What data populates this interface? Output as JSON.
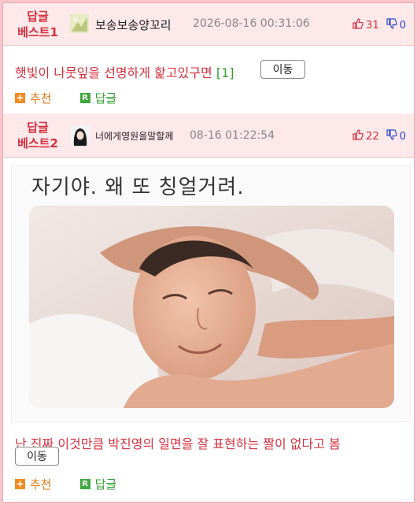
{
  "best1": {
    "label_line1": "답글",
    "label_line2": "베스트1",
    "nickname": "보송보송양꼬리",
    "date": "2026-08-16 00:31:06",
    "up_count": "31",
    "down_count": "0"
  },
  "comment1": {
    "text": "햇빛이 나뭇잎을 선명하게 핥고있구면",
    "count": "[1]",
    "move_label": "이동",
    "recommend_label": "추천",
    "reply_label": "답글"
  },
  "best2": {
    "label_line1": "답글",
    "label_line2": "베스트2",
    "nickname": "너에게영원을말할께",
    "date": "08-16 01:22:54",
    "up_count": "22",
    "down_count": "0"
  },
  "meme": {
    "caption": "자기야. 왜 또 칭얼거려."
  },
  "comment2": {
    "text": "난 진짜 이것만큼 박진영의 일면을 잘 표현하는 짤이 없다고 봄",
    "move_label": "이동",
    "recommend_label": "추천",
    "reply_label": "답글"
  },
  "icons": {
    "thumb_up": "thumbs-up-icon",
    "thumb_down": "thumbs-down-icon",
    "plus": "plus-icon",
    "reply": "reply-icon"
  },
  "colors": {
    "accent_red": "#d4303d",
    "accent_blue": "#2a4bc8",
    "accent_green": "#2f9e2f",
    "header_bg": "#fde8ea",
    "frame_border": "#f7c5cc"
  }
}
